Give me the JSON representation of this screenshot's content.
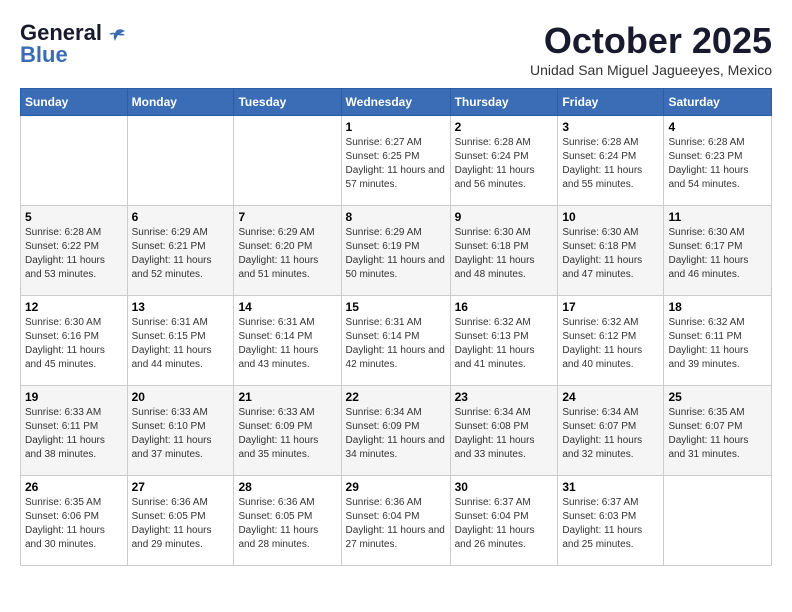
{
  "logo": {
    "general": "General",
    "blue": "Blue"
  },
  "header": {
    "month": "October 2025",
    "location": "Unidad San Miguel Jagueeyes, Mexico"
  },
  "days_of_week": [
    "Sunday",
    "Monday",
    "Tuesday",
    "Wednesday",
    "Thursday",
    "Friday",
    "Saturday"
  ],
  "weeks": [
    [
      {
        "day": "",
        "info": ""
      },
      {
        "day": "",
        "info": ""
      },
      {
        "day": "",
        "info": ""
      },
      {
        "day": "1",
        "info": "Sunrise: 6:27 AM\nSunset: 6:25 PM\nDaylight: 11 hours and 57 minutes."
      },
      {
        "day": "2",
        "info": "Sunrise: 6:28 AM\nSunset: 6:24 PM\nDaylight: 11 hours and 56 minutes."
      },
      {
        "day": "3",
        "info": "Sunrise: 6:28 AM\nSunset: 6:24 PM\nDaylight: 11 hours and 55 minutes."
      },
      {
        "day": "4",
        "info": "Sunrise: 6:28 AM\nSunset: 6:23 PM\nDaylight: 11 hours and 54 minutes."
      }
    ],
    [
      {
        "day": "5",
        "info": "Sunrise: 6:28 AM\nSunset: 6:22 PM\nDaylight: 11 hours and 53 minutes."
      },
      {
        "day": "6",
        "info": "Sunrise: 6:29 AM\nSunset: 6:21 PM\nDaylight: 11 hours and 52 minutes."
      },
      {
        "day": "7",
        "info": "Sunrise: 6:29 AM\nSunset: 6:20 PM\nDaylight: 11 hours and 51 minutes."
      },
      {
        "day": "8",
        "info": "Sunrise: 6:29 AM\nSunset: 6:19 PM\nDaylight: 11 hours and 50 minutes."
      },
      {
        "day": "9",
        "info": "Sunrise: 6:30 AM\nSunset: 6:18 PM\nDaylight: 11 hours and 48 minutes."
      },
      {
        "day": "10",
        "info": "Sunrise: 6:30 AM\nSunset: 6:18 PM\nDaylight: 11 hours and 47 minutes."
      },
      {
        "day": "11",
        "info": "Sunrise: 6:30 AM\nSunset: 6:17 PM\nDaylight: 11 hours and 46 minutes."
      }
    ],
    [
      {
        "day": "12",
        "info": "Sunrise: 6:30 AM\nSunset: 6:16 PM\nDaylight: 11 hours and 45 minutes."
      },
      {
        "day": "13",
        "info": "Sunrise: 6:31 AM\nSunset: 6:15 PM\nDaylight: 11 hours and 44 minutes."
      },
      {
        "day": "14",
        "info": "Sunrise: 6:31 AM\nSunset: 6:14 PM\nDaylight: 11 hours and 43 minutes."
      },
      {
        "day": "15",
        "info": "Sunrise: 6:31 AM\nSunset: 6:14 PM\nDaylight: 11 hours and 42 minutes."
      },
      {
        "day": "16",
        "info": "Sunrise: 6:32 AM\nSunset: 6:13 PM\nDaylight: 11 hours and 41 minutes."
      },
      {
        "day": "17",
        "info": "Sunrise: 6:32 AM\nSunset: 6:12 PM\nDaylight: 11 hours and 40 minutes."
      },
      {
        "day": "18",
        "info": "Sunrise: 6:32 AM\nSunset: 6:11 PM\nDaylight: 11 hours and 39 minutes."
      }
    ],
    [
      {
        "day": "19",
        "info": "Sunrise: 6:33 AM\nSunset: 6:11 PM\nDaylight: 11 hours and 38 minutes."
      },
      {
        "day": "20",
        "info": "Sunrise: 6:33 AM\nSunset: 6:10 PM\nDaylight: 11 hours and 37 minutes."
      },
      {
        "day": "21",
        "info": "Sunrise: 6:33 AM\nSunset: 6:09 PM\nDaylight: 11 hours and 35 minutes."
      },
      {
        "day": "22",
        "info": "Sunrise: 6:34 AM\nSunset: 6:09 PM\nDaylight: 11 hours and 34 minutes."
      },
      {
        "day": "23",
        "info": "Sunrise: 6:34 AM\nSunset: 6:08 PM\nDaylight: 11 hours and 33 minutes."
      },
      {
        "day": "24",
        "info": "Sunrise: 6:34 AM\nSunset: 6:07 PM\nDaylight: 11 hours and 32 minutes."
      },
      {
        "day": "25",
        "info": "Sunrise: 6:35 AM\nSunset: 6:07 PM\nDaylight: 11 hours and 31 minutes."
      }
    ],
    [
      {
        "day": "26",
        "info": "Sunrise: 6:35 AM\nSunset: 6:06 PM\nDaylight: 11 hours and 30 minutes."
      },
      {
        "day": "27",
        "info": "Sunrise: 6:36 AM\nSunset: 6:05 PM\nDaylight: 11 hours and 29 minutes."
      },
      {
        "day": "28",
        "info": "Sunrise: 6:36 AM\nSunset: 6:05 PM\nDaylight: 11 hours and 28 minutes."
      },
      {
        "day": "29",
        "info": "Sunrise: 6:36 AM\nSunset: 6:04 PM\nDaylight: 11 hours and 27 minutes."
      },
      {
        "day": "30",
        "info": "Sunrise: 6:37 AM\nSunset: 6:04 PM\nDaylight: 11 hours and 26 minutes."
      },
      {
        "day": "31",
        "info": "Sunrise: 6:37 AM\nSunset: 6:03 PM\nDaylight: 11 hours and 25 minutes."
      },
      {
        "day": "",
        "info": ""
      }
    ]
  ]
}
